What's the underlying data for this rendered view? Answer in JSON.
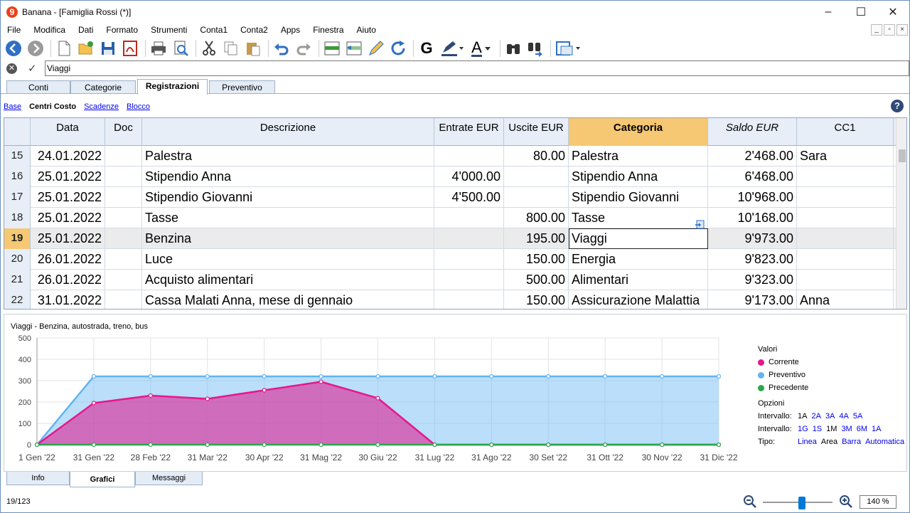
{
  "window": {
    "title": "Banana - [Famiglia Rossi (*)]",
    "app_icon_glyph": "9",
    "controls": [
      "–",
      "☐",
      "✕"
    ]
  },
  "menu": [
    "File",
    "Modifica",
    "Dati",
    "Formato",
    "Strumenti",
    "Conta1",
    "Conta2",
    "Apps",
    "Finestra",
    "Aiuto"
  ],
  "toolbar": {
    "icons": [
      "back-icon",
      "forward-icon",
      "new-file-icon",
      "open-folder-icon",
      "save-icon",
      "pdf-icon",
      "print-icon",
      "print-preview-icon",
      "cut-icon",
      "copy-icon",
      "paste-icon",
      "undo-icon",
      "redo-icon",
      "add-rows-icon",
      "duplicate-rows-icon",
      "edit-icon",
      "recalculate-icon",
      "bold-icon",
      "highlight-icon",
      "text-color-icon",
      "find-icon",
      "find-replace-icon",
      "window-icon"
    ],
    "bold_glyph": "G",
    "text_color_glyph": "A"
  },
  "editline": {
    "value": "Viaggi"
  },
  "tabs": [
    "Conti",
    "Categorie",
    "Registrazioni",
    "Preventivo"
  ],
  "active_tab": "Registrazioni",
  "views": [
    "Base",
    "Centri Costo",
    "Scadenze",
    "Blocco"
  ],
  "active_view": "Centri Costo",
  "help_glyph": "?",
  "grid": {
    "columns": [
      "",
      "Data",
      "Doc",
      "Descrizione",
      "Entrate EUR",
      "Uscite EUR",
      "Categoria",
      "Saldo EUR",
      "CC1"
    ],
    "rows": [
      {
        "n": "15",
        "date": "24.01.2022",
        "doc": "",
        "desc": "Palestra",
        "income": "",
        "expense": "80.00",
        "cat": "Palestra",
        "balance": "2'468.00",
        "cc1": "Sara"
      },
      {
        "n": "16",
        "date": "25.01.2022",
        "doc": "",
        "desc": "Stipendio Anna",
        "income": "4'000.00",
        "expense": "",
        "cat": "Stipendio Anna",
        "balance": "6'468.00",
        "cc1": ""
      },
      {
        "n": "17",
        "date": "25.01.2022",
        "doc": "",
        "desc": "Stipendio Giovanni",
        "income": "4'500.00",
        "expense": "",
        "cat": "Stipendio Giovanni",
        "balance": "10'968.00",
        "cc1": ""
      },
      {
        "n": "18",
        "date": "25.01.2022",
        "doc": "",
        "desc": "Tasse",
        "income": "",
        "expense": "800.00",
        "cat": "Tasse",
        "balance": "10'168.00",
        "cc1": ""
      },
      {
        "n": "19",
        "date": "25.01.2022",
        "doc": "",
        "desc": "Benzina",
        "income": "",
        "expense": "195.00",
        "cat": "Viaggi",
        "balance": "9'973.00",
        "cc1": ""
      },
      {
        "n": "20",
        "date": "26.01.2022",
        "doc": "",
        "desc": "Luce",
        "income": "",
        "expense": "150.00",
        "cat": "Energia",
        "balance": "9'823.00",
        "cc1": ""
      },
      {
        "n": "21",
        "date": "26.01.2022",
        "doc": "",
        "desc": "Acquisto alimentari",
        "income": "",
        "expense": "500.00",
        "cat": "Alimentari",
        "balance": "9'323.00",
        "cc1": ""
      },
      {
        "n": "22",
        "date": "31.01.2022",
        "doc": "",
        "desc": "Cassa Malati Anna, mese di gennaio",
        "income": "",
        "expense": "150.00",
        "cat": "Assicurazione Malattia",
        "balance": "9'173.00",
        "cc1": "Anna"
      }
    ],
    "current_row": "19"
  },
  "chart_data": {
    "type": "area",
    "title": "Viaggi - Benzina, autostrada, treno, bus",
    "x": [
      "1 Gen '22",
      "31 Gen '22",
      "28 Feb '22",
      "31 Mar '22",
      "30 Apr '22",
      "31 Mag '22",
      "30 Giu '22",
      "31 Lug '22",
      "31 Ago '22",
      "30 Set '22",
      "31 Ott '22",
      "30 Nov '22",
      "31 Dic '22"
    ],
    "ylim": [
      0,
      500
    ],
    "yticks": [
      0,
      100,
      200,
      300,
      400,
      500
    ],
    "grid": true,
    "series": [
      {
        "name": "Corrente",
        "color": "#e8168c",
        "values": [
          0,
          195,
          230,
          215,
          255,
          295,
          218,
          0,
          0,
          0,
          0,
          0,
          0
        ]
      },
      {
        "name": "Preventivo",
        "color": "#60b4f0",
        "values": [
          0,
          320,
          320,
          320,
          320,
          320,
          320,
          320,
          320,
          320,
          320,
          320,
          320
        ]
      },
      {
        "name": "Precedente",
        "color": "#2aa84a",
        "values": [
          0,
          0,
          0,
          0,
          0,
          0,
          0,
          0,
          0,
          0,
          0,
          0,
          0
        ]
      }
    ],
    "legend_title": "Valori",
    "legend_position": "right"
  },
  "options": {
    "title": "Opzioni",
    "rows": [
      {
        "label": "Intervallo:",
        "items": [
          "1A",
          "2A",
          "3A",
          "4A",
          "5A"
        ],
        "selected": "1A"
      },
      {
        "label": "Intervallo:",
        "items": [
          "1G",
          "1S",
          "1M",
          "3M",
          "6M",
          "1A"
        ],
        "selected": "1M"
      },
      {
        "label": "Tipo:",
        "items": [
          "Linea",
          "Area",
          "Barra",
          "Automatica"
        ],
        "selected": "Area"
      }
    ]
  },
  "bottom_tabs": [
    "Info",
    "Grafici",
    "Messaggi"
  ],
  "active_bottom_tab": "Grafici",
  "status": {
    "position": "19/123",
    "zoom": "140 %"
  }
}
